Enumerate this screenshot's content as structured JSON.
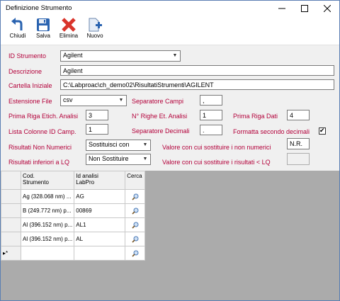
{
  "window": {
    "title": "Definizione Strumento"
  },
  "toolbar": {
    "close": "Chiudi",
    "save": "Salva",
    "delete": "Elimina",
    "new": "Nuovo"
  },
  "form": {
    "id_label": "ID Strumento",
    "id_value": "Agilent",
    "desc_label": "Descrizione",
    "desc_value": "Agilent",
    "folder_label": "Cartella Iniziale",
    "folder_value": "C:\\Labproac\\ch_demo02\\RisultatiStrumenti\\AGILENT",
    "ext_label": "Estensione File",
    "ext_value": "csv",
    "sep_fields_label": "Separatore Campi",
    "sep_fields_value": ",",
    "first_row_label": "Prima Riga Etich. Analisi",
    "first_row_value": "3",
    "num_rows_label": "N° Righe Et. Analisi",
    "num_rows_value": "1",
    "first_data_label": "Prima Riga Dati",
    "first_data_value": "4",
    "cols_label": "Lista Colonne ID Camp.",
    "cols_value": "1",
    "sep_dec_label": "Separatore Decimali",
    "sep_dec_value": ".",
    "format_dec_label": "Formatta secondo decimali",
    "format_dec_checked": "✔",
    "nonnum_label": "Risultati Non Numerici",
    "nonnum_value": "Sostituisci con",
    "nonnum_repl_label": "Valore con cui sostituire i non numerici",
    "nonnum_repl_value": "N.R.",
    "lq_label": "Risultati inferiori a LQ",
    "lq_value": "Non Sostituire",
    "lq_repl_label": "Valore con cui sostituire i risultati < LQ",
    "lq_repl_value": ""
  },
  "grid": {
    "headers": [
      "Cod.\nStrumento",
      "Id analisi\nLabPro",
      "Cerca"
    ],
    "rows": [
      {
        "cod": "Ag (328.068 nm) ...",
        "id": "AG"
      },
      {
        "cod": "B (249.772 nm) p...",
        "id": "00869"
      },
      {
        "cod": "Al (396.152 nm) p...",
        "id": "AL1"
      },
      {
        "cod": "Al (396.152 nm) p...",
        "id": "AL"
      }
    ],
    "new_row_marker": "▸*"
  },
  "icons": [
    "back-arrow-icon",
    "floppy-disk-icon",
    "delete-x-icon",
    "new-document-icon",
    "search-icon",
    "minimize-icon",
    "maximize-icon",
    "close-icon"
  ],
  "colors": {
    "label": "#b3003a",
    "toolbar_blue": "#2a63b0",
    "delete_red": "#d9342b"
  }
}
